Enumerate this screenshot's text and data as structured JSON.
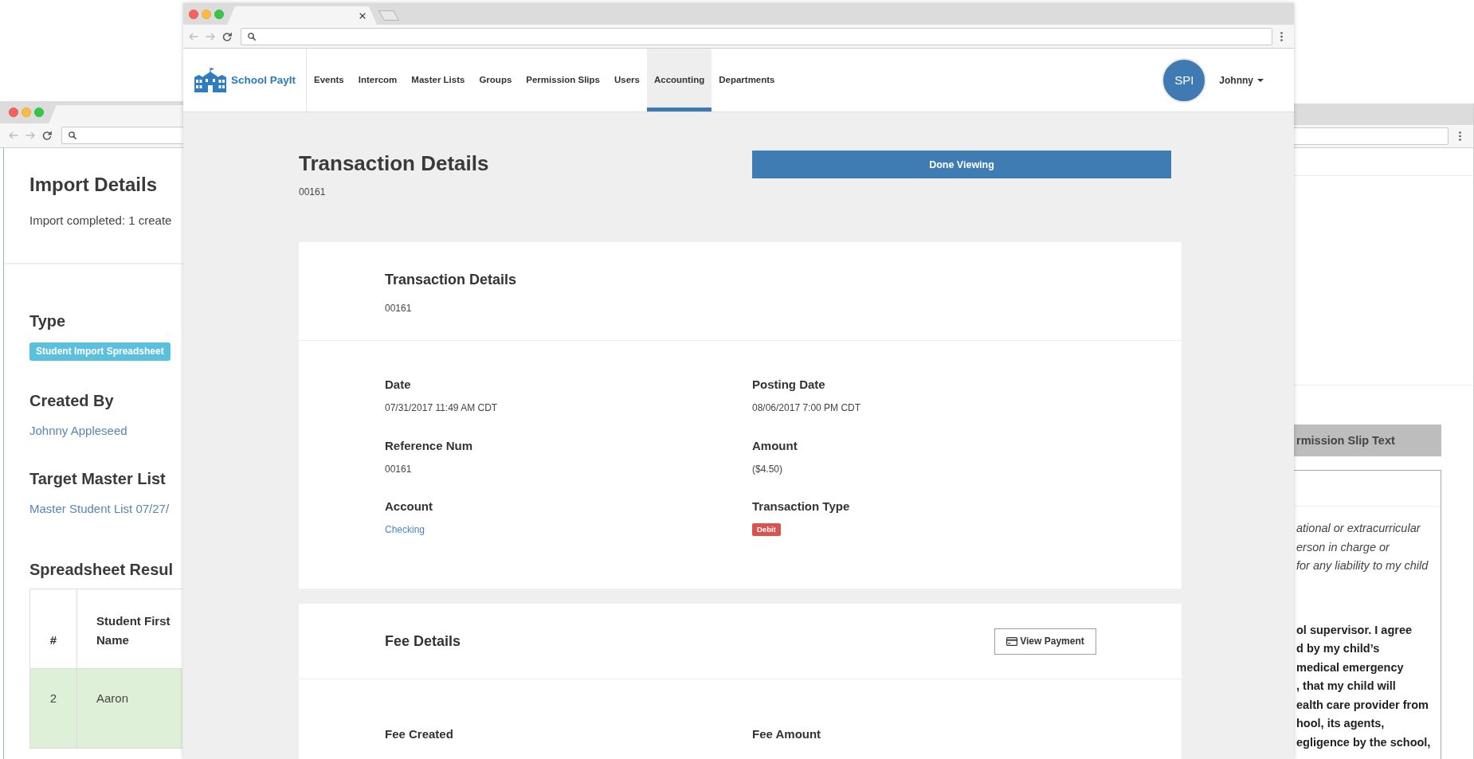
{
  "main_window": {
    "brand": "School PayIt",
    "nav": [
      {
        "label": "Events",
        "selected": false
      },
      {
        "label": "Intercom",
        "selected": false
      },
      {
        "label": "Master Lists",
        "selected": false
      },
      {
        "label": "Groups",
        "selected": false
      },
      {
        "label": "Permission Slips",
        "selected": false
      },
      {
        "label": "Users",
        "selected": false
      },
      {
        "label": "Accounting",
        "selected": true
      },
      {
        "label": "Departments",
        "selected": false
      }
    ],
    "avatar": "SPI",
    "user_menu": "Johnny",
    "page_title": "Transaction Details",
    "page_subtitle": "00161",
    "done_button": "Done Viewing",
    "transaction_card": {
      "title": "Transaction Details",
      "subtitle": "00161",
      "fields": [
        {
          "label": "Date",
          "value": "07/31/2017 11:49 AM CDT",
          "kind": "text"
        },
        {
          "label": "Posting Date",
          "value": "08/06/2017 7:00 PM CDT",
          "kind": "text"
        },
        {
          "label": "Reference Num",
          "value": "00161",
          "kind": "text"
        },
        {
          "label": "Amount",
          "value": "($4.50)",
          "kind": "text"
        },
        {
          "label": "Account",
          "value": "Checking",
          "kind": "link"
        },
        {
          "label": "Transaction Type",
          "value": "Debit",
          "kind": "badge"
        }
      ]
    },
    "fee_card": {
      "title": "Fee Details",
      "button": "View Payment",
      "fields": [
        {
          "label": "Fee Created"
        },
        {
          "label": "Fee Amount"
        }
      ]
    }
  },
  "import_window": {
    "title": "Import Details",
    "summary": "Import completed: 1 create",
    "sections": [
      {
        "heading": "Type",
        "value": "Student Import Spreadsheet",
        "kind": "badge"
      },
      {
        "heading": "Created By",
        "value": "Johnny Appleseed",
        "kind": "link"
      },
      {
        "heading": "Target Master List",
        "value": "Master Student List 07/27/",
        "kind": "link"
      }
    ],
    "results_heading": "Spreadsheet Resul",
    "table": {
      "columns": [
        "#",
        "Student First Name"
      ],
      "rows": [
        {
          "cells": [
            "2",
            "Aaron"
          ],
          "highlighted": true
        }
      ]
    }
  },
  "permission_slip_window": {
    "section_header": "rmission Slip Text",
    "paragraphs": [
      {
        "kind": "italic",
        "lines": [
          "ational or extracurricular",
          "erson in charge or",
          "for any liability to my child"
        ]
      },
      {
        "kind": "bold",
        "lines": [
          "ol supervisor. I agree",
          "d by my child’s",
          "medical emergency",
          ", that my child will",
          "ealth care provider from",
          "hool, its agents,",
          "egligence by the school,"
        ]
      }
    ]
  }
}
